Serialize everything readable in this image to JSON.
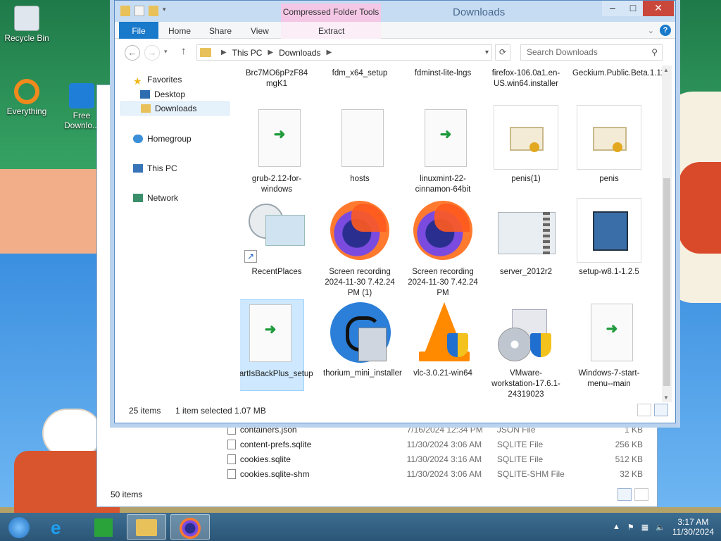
{
  "desktop": {
    "icons": [
      {
        "label": "Recycle Bin"
      },
      {
        "label": "Everything"
      },
      {
        "label": "Free Downlo..."
      }
    ]
  },
  "back_window": {
    "files": [
      {
        "name": "containers.json",
        "date": "7/16/2024 12:34 PM",
        "type": "JSON File",
        "size": "1 KB"
      },
      {
        "name": "content-prefs.sqlite",
        "date": "11/30/2024 3:06 AM",
        "type": "SQLITE File",
        "size": "256 KB"
      },
      {
        "name": "cookies.sqlite",
        "date": "11/30/2024 3:16 AM",
        "type": "SQLITE File",
        "size": "512 KB"
      },
      {
        "name": "cookies.sqlite-shm",
        "date": "11/30/2024 3:06 AM",
        "type": "SQLITE-SHM File",
        "size": "32 KB"
      }
    ],
    "status": "50 items"
  },
  "window": {
    "title": "Downloads",
    "context_tab": "Compressed Folder Tools",
    "ribbon_tabs": {
      "file": "File",
      "home": "Home",
      "share": "Share",
      "view": "View",
      "extract": "Extract"
    },
    "address": {
      "root": "This PC",
      "folder": "Downloads"
    },
    "search_placeholder": "Search Downloads",
    "nav": {
      "favorites": "Favorites",
      "desktop": "Desktop",
      "downloads": "Downloads",
      "homegroup": "Homegroup",
      "this_pc": "This PC",
      "network": "Network"
    },
    "files": [
      {
        "name": "Brc7MO6pPzF84 mgK1"
      },
      {
        "name": "fdm_x64_setup"
      },
      {
        "name": "fdminst-lite-lngs"
      },
      {
        "name": "firefox-106.0a1.en-US.win64.installer"
      },
      {
        "name": "Geckium.Public.Beta.1.11.0"
      },
      {
        "name": "grub-2.12-for-windows"
      },
      {
        "name": "hosts"
      },
      {
        "name": "linuxmint-22-cinnamon-64bit"
      },
      {
        "name": "penis(1)"
      },
      {
        "name": "penis"
      },
      {
        "name": "RecentPlaces"
      },
      {
        "name": "Screen recording 2024-11-30 7.42.24 PM (1)"
      },
      {
        "name": "Screen recording 2024-11-30 7.42.24 PM"
      },
      {
        "name": "server_2012r2"
      },
      {
        "name": "setup-w8.1-1.2.5"
      },
      {
        "name": "StartIsBackPlus_setup"
      },
      {
        "name": "thorium_mini_installer"
      },
      {
        "name": "vlc-3.0.21-win64"
      },
      {
        "name": "VMware-workstation-17.6.1-24319023"
      },
      {
        "name": "Windows-7-start-menu--main"
      }
    ],
    "status": {
      "items": "25 items",
      "selection": "1 item selected  1.07 MB"
    }
  },
  "taskbar": {
    "clock_time": "3:17 AM",
    "clock_date": "11/30/2024"
  }
}
